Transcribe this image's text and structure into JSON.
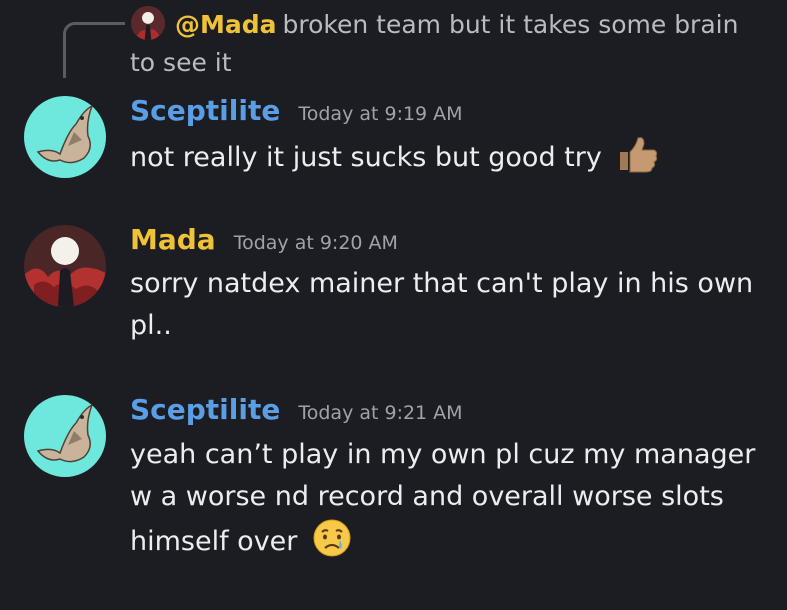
{
  "reply": {
    "username": "@Mada",
    "text": "broken team but it takes some brain to see it"
  },
  "messages": [
    {
      "username": "Sceptilite",
      "username_color": "#5a9ee6",
      "timestamp": "Today at 9:19 AM",
      "text": "not really it just sucks but good try",
      "emoji": "thumbs-up-icon",
      "avatar": "sceptile-avatar"
    },
    {
      "username": "Mada",
      "username_color": "#f0c238",
      "timestamp": "Today at 9:20 AM",
      "text": "sorry natdex mainer that can't play in his own pl..",
      "avatar": "red-moon-avatar"
    },
    {
      "username": "Sceptilite",
      "username_color": "#5a9ee6",
      "timestamp": "Today at 9:21 AM",
      "text": "yeah can’t play in my own pl cuz my manager w a worse nd record and overall worse slots himself over",
      "emoji": "crying-face-icon",
      "avatar": "sceptile-avatar"
    }
  ]
}
